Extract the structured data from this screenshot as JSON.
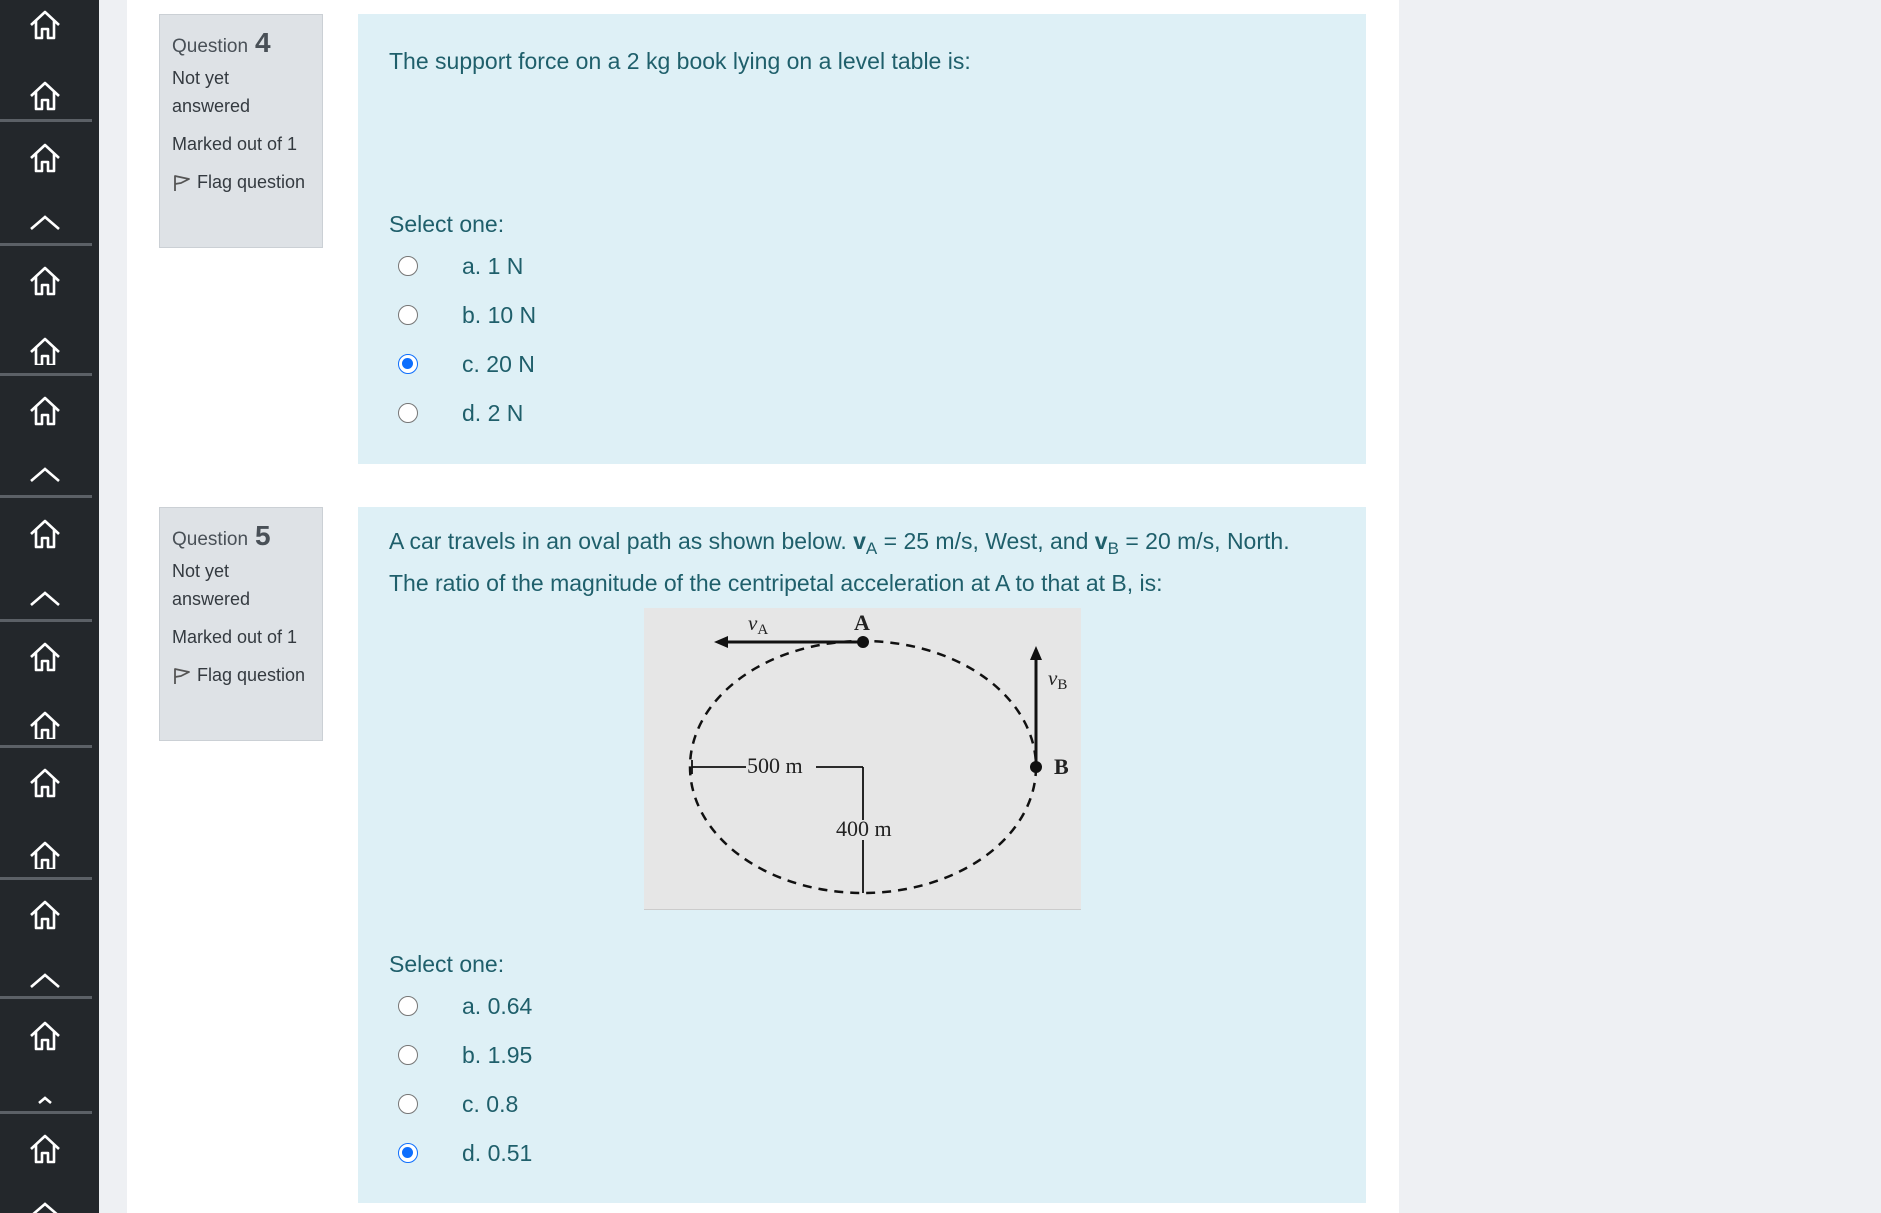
{
  "sidebar": {
    "items": [
      {
        "icon": "home-icon"
      },
      {
        "icon": "home-icon"
      },
      {
        "icon": "home-icon"
      },
      {
        "icon": "chevron-up-icon"
      },
      {
        "icon": "home-icon"
      },
      {
        "icon": "home-icon"
      },
      {
        "icon": "home-icon"
      },
      {
        "icon": "chevron-up-icon"
      },
      {
        "icon": "home-icon"
      },
      {
        "icon": "chevron-up-icon"
      },
      {
        "icon": "home-icon"
      },
      {
        "icon": "home-icon"
      },
      {
        "icon": "home-icon"
      },
      {
        "icon": "home-icon"
      },
      {
        "icon": "home-icon"
      },
      {
        "icon": "chevron-up-icon"
      },
      {
        "icon": "home-icon"
      },
      {
        "icon": "chevron-up-icon"
      },
      {
        "icon": "home-icon"
      },
      {
        "icon": "chevron-up-icon"
      }
    ]
  },
  "questions": [
    {
      "label": "Question",
      "number": "4",
      "state": "Not yet answered",
      "grade": "Marked out of 1",
      "flag": "Flag question",
      "text": "The support force on a 2 kg book lying on a level table is:",
      "select_prompt": "Select one:",
      "options": [
        {
          "label": "a. 1 N",
          "checked": false
        },
        {
          "label": "b. 10 N",
          "checked": false
        },
        {
          "label": "c. 20 N",
          "checked": true
        },
        {
          "label": "d. 2 N",
          "checked": false
        }
      ]
    },
    {
      "label": "Question",
      "number": "5",
      "state": "Not yet answered",
      "grade": "Marked out of 1",
      "flag": "Flag question",
      "text_line1": {
        "pre": "A car travels in an oval path as shown below. ",
        "va_symbol": "v",
        "va_sub": "A",
        "va_rest": " = 25 m/s, West, and ",
        "vb_symbol": "v",
        "vb_sub": "B",
        "vb_rest": " = 20 m/s, North."
      },
      "text_line2": "The ratio of the magnitude of the centripetal acceleration at A to that at B, is:",
      "figure": {
        "label_va": "v",
        "label_va_sub": "A",
        "label_a": "A",
        "label_vb": "v",
        "label_vb_sub": "B",
        "label_b": "B",
        "label_500": "500 m",
        "label_400": "400 m"
      },
      "select_prompt": "Select one:",
      "options": [
        {
          "label": "a. 0.64",
          "checked": false
        },
        {
          "label": "b. 1.95",
          "checked": false
        },
        {
          "label": "c. 0.8",
          "checked": false
        },
        {
          "label": "d. 0.51",
          "checked": true
        }
      ]
    }
  ]
}
